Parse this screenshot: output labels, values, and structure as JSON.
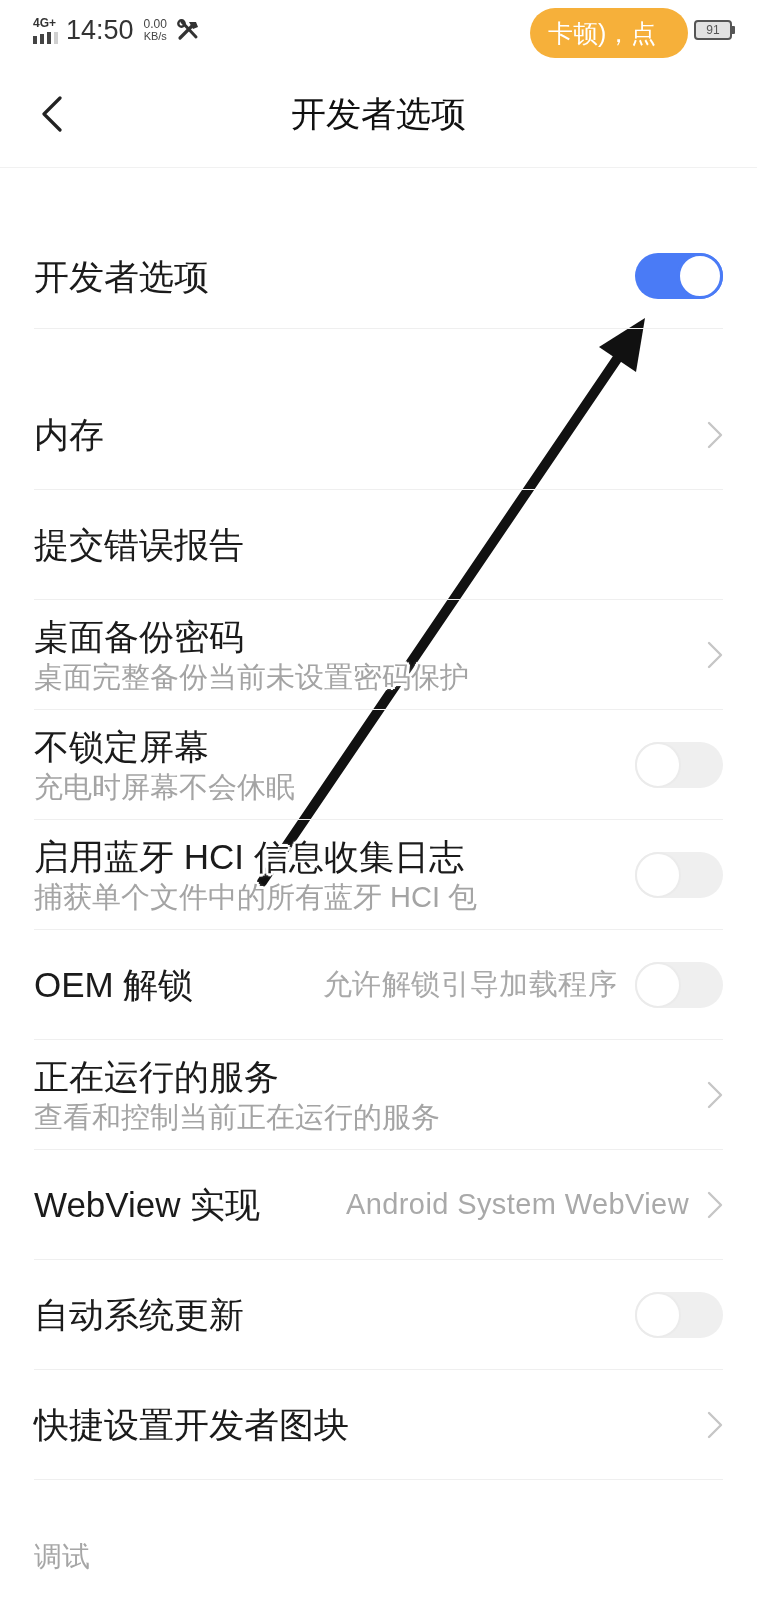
{
  "status_bar": {
    "network": "4G+",
    "time": "14:50",
    "speed_value": "0.00",
    "speed_unit": "KB/s",
    "battery": "91"
  },
  "floating_notice": {
    "text": "卡顿)，点"
  },
  "header": {
    "title": "开发者选项"
  },
  "master_switch": {
    "label": "开发者选项",
    "on": true
  },
  "items": [
    {
      "kind": "link",
      "label": "内存"
    },
    {
      "kind": "plain",
      "label": "提交错误报告"
    },
    {
      "kind": "link",
      "label": "桌面备份密码",
      "subtitle": "桌面完整备份当前未设置密码保护"
    },
    {
      "kind": "switch",
      "label": "不锁定屏幕",
      "subtitle": "充电时屏幕不会休眠",
      "on": false
    },
    {
      "kind": "switch",
      "label": "启用蓝牙 HCI 信息收集日志",
      "subtitle": "捕获单个文件中的所有蓝牙 HCI 包",
      "on": false
    },
    {
      "kind": "switch",
      "label": "OEM 解锁",
      "value": "允许解锁引导加载程序",
      "on": false
    },
    {
      "kind": "link",
      "label": "正在运行的服务",
      "subtitle": "查看和控制当前正在运行的服务"
    },
    {
      "kind": "link",
      "label": "WebView 实现",
      "value": "Android System WebView"
    },
    {
      "kind": "switch",
      "label": "自动系统更新",
      "on": false
    },
    {
      "kind": "link",
      "label": "快捷设置开发者图块"
    }
  ],
  "section_header": {
    "title": "调试"
  }
}
